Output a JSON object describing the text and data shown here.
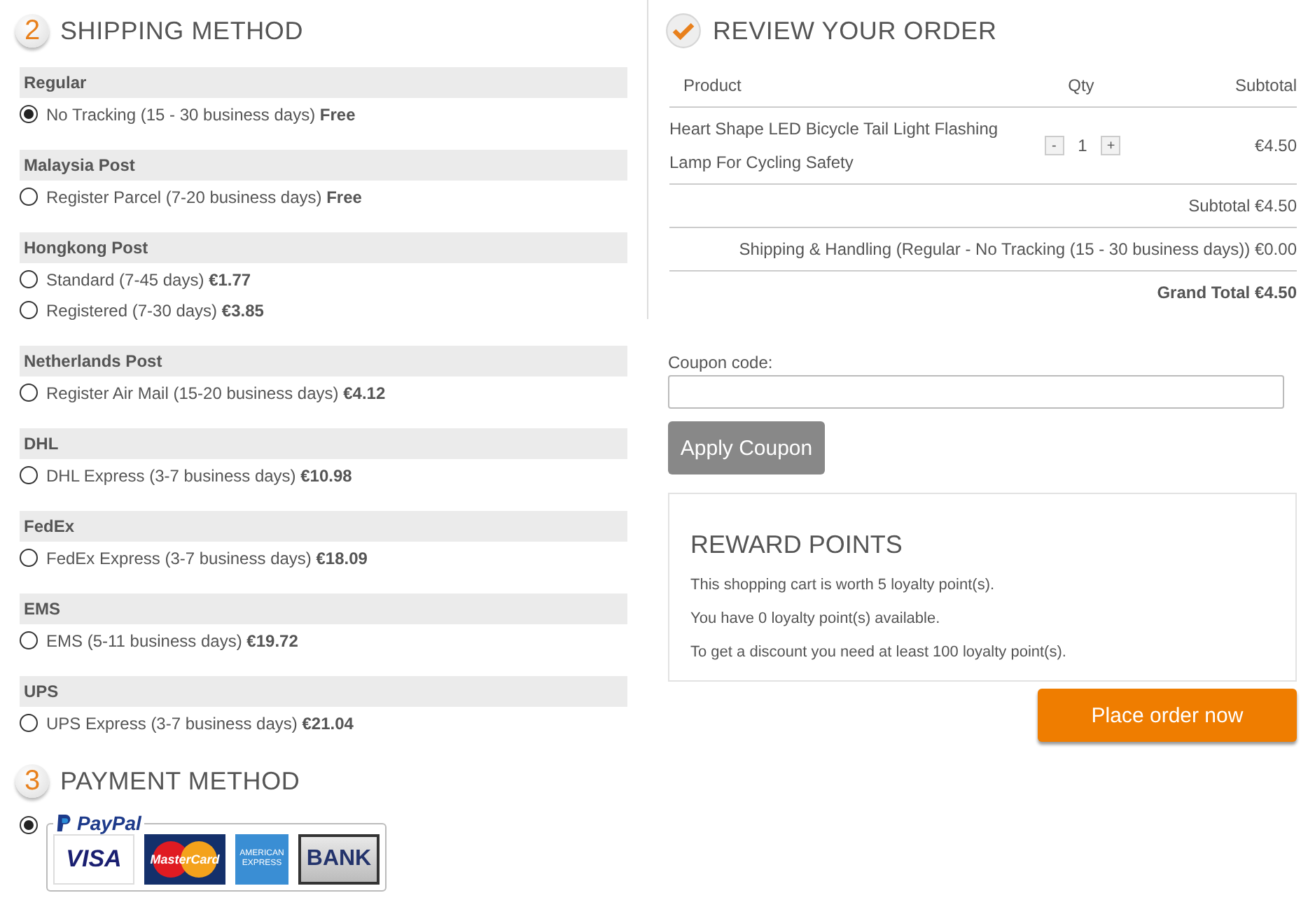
{
  "shipping": {
    "step": "2",
    "title": "SHIPPING METHOD",
    "groups": [
      {
        "name": "Regular",
        "options": [
          {
            "text": "No Tracking (15 - 30 business days)",
            "price": "Free",
            "selected": true
          }
        ]
      },
      {
        "name": "Malaysia Post",
        "options": [
          {
            "text": "Register Parcel (7-20 business days)",
            "price": "Free",
            "selected": false
          }
        ]
      },
      {
        "name": "Hongkong Post",
        "options": [
          {
            "text": "Standard (7-45 days)",
            "price": "€1.77",
            "selected": false
          },
          {
            "text": "Registered (7-30 days)",
            "price": "€3.85",
            "selected": false
          }
        ]
      },
      {
        "name": "Netherlands Post",
        "options": [
          {
            "text": "Register Air Mail (15-20 business days)",
            "price": "€4.12",
            "selected": false
          }
        ]
      },
      {
        "name": "DHL",
        "options": [
          {
            "text": "DHL Express (3-7 business days)",
            "price": "€10.98",
            "selected": false
          }
        ]
      },
      {
        "name": "FedEx",
        "options": [
          {
            "text": "FedEx Express (3-7 business days)",
            "price": "€18.09",
            "selected": false
          }
        ]
      },
      {
        "name": "EMS",
        "options": [
          {
            "text": "EMS (5-11 business days)",
            "price": "€19.72",
            "selected": false
          }
        ]
      },
      {
        "name": "UPS",
        "options": [
          {
            "text": "UPS Express (3-7 business days)",
            "price": "€21.04",
            "selected": false
          }
        ]
      }
    ]
  },
  "payment": {
    "step": "3",
    "title": "PAYMENT METHOD",
    "methods": [
      {
        "selected": true,
        "brand": "PayPal",
        "cards": [
          {
            "kind": "visa",
            "label": "VISA"
          },
          {
            "kind": "mastercard",
            "label": "MasterCard"
          },
          {
            "kind": "amex",
            "label": "AMERICAN EXPRESS"
          },
          {
            "kind": "bank",
            "label": "BANK"
          }
        ]
      }
    ]
  },
  "review": {
    "title": "REVIEW YOUR ORDER",
    "columns": [
      "Product",
      "Qty",
      "Subtotal"
    ],
    "items": [
      {
        "product": "Heart Shape LED Bicycle Tail Light Flashing Lamp For Cycling Safety",
        "minus": "-",
        "qty": "1",
        "plus": "+",
        "subtotal": "€4.50"
      }
    ],
    "totals": [
      {
        "text": "Subtotal €4.50",
        "kind": "normal"
      },
      {
        "text": "Shipping & Handling (Regular - No Tracking (15 - 30 business days)) €0.00",
        "kind": "normal"
      },
      {
        "text": "Grand Total €4.50",
        "kind": "grand"
      }
    ]
  },
  "coupon": {
    "label": "Coupon code:",
    "button": "Apply Coupon"
  },
  "reward": {
    "title": "REWARD POINTS",
    "lines": [
      "This shopping cart is worth 5 loyalty point(s).",
      "You have 0 loyalty point(s) available.",
      "To get a discount you need at least 100 loyalty point(s)."
    ]
  },
  "place_order": "Place order now"
}
